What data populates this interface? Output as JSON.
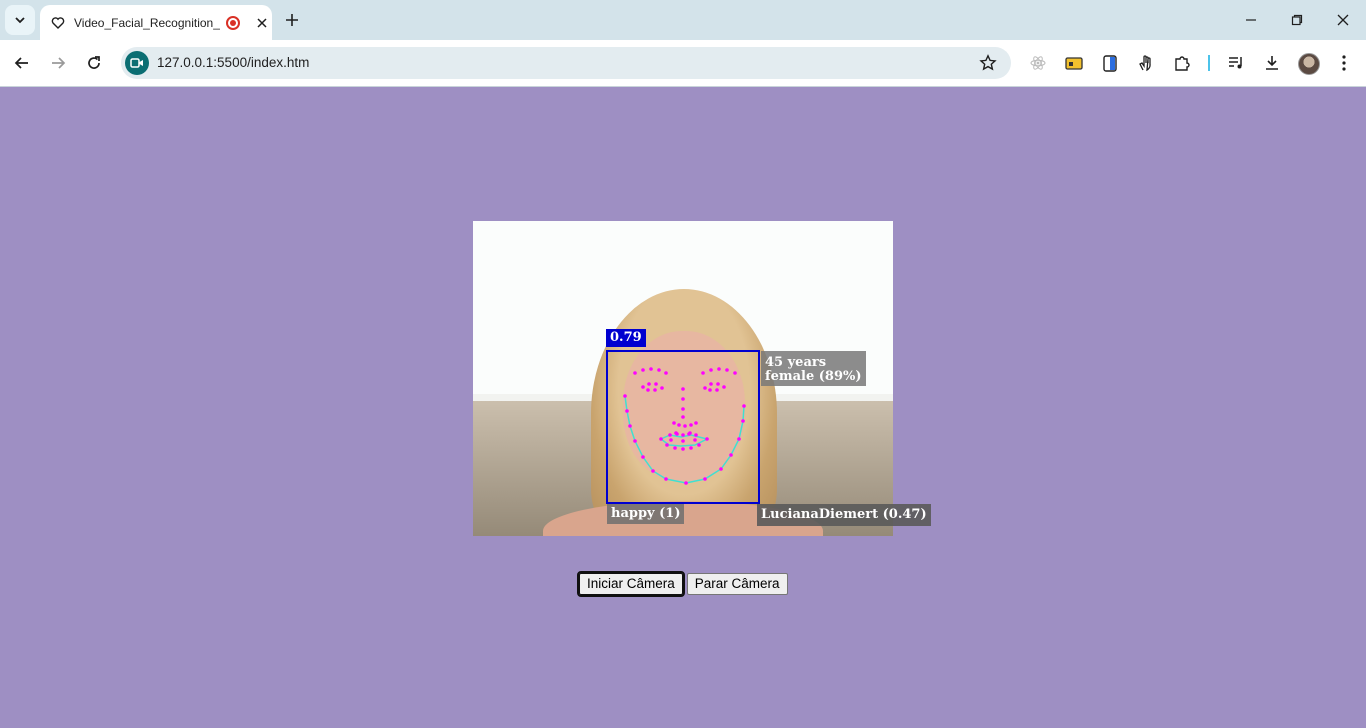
{
  "browser": {
    "tab": {
      "title": "Video_Facial_Recognition_JS",
      "favicon": "heart-icon",
      "recording_indicator": "record-icon"
    },
    "address": {
      "url": "127.0.0.1:5500/index.htm",
      "site_icon": "camera-icon"
    },
    "extensions": [
      "react-devtools-icon",
      "folder-icon",
      "clipboard-icon",
      "hand-icon",
      "puzzle-icon",
      "media-icon",
      "download-icon",
      "profile-avatar",
      "menu-icon"
    ]
  },
  "video": {
    "detection_score": "0.79",
    "age_label": "45 years",
    "gender_label": "female (89%)",
    "expression_label": "happy (1)",
    "identity_label": "LucianaDiemert (0.47)"
  },
  "controls": {
    "start_label": "Iniciar Câmera",
    "stop_label": "Parar Câmera"
  },
  "colors": {
    "page_bg": "#9e8fc3",
    "box": "#0000d0",
    "landmark": "#ff00ff",
    "contour": "#40e0d0"
  }
}
